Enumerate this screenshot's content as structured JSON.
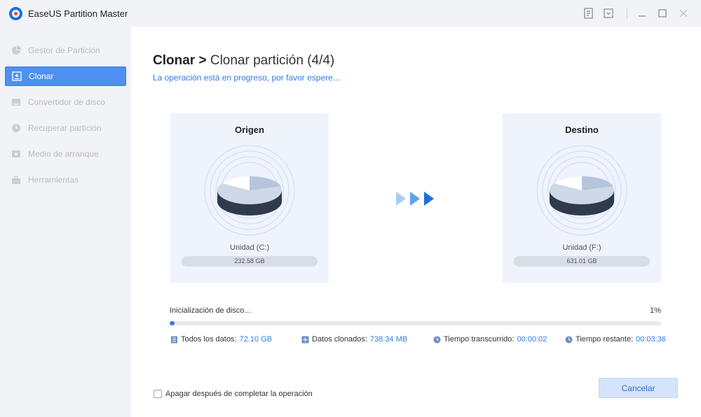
{
  "app": {
    "title": "EaseUS Partition Master"
  },
  "sidebar": {
    "items": [
      {
        "label": "Gestor de Partición",
        "icon": "pie-chart-icon",
        "active": false
      },
      {
        "label": "Clonar",
        "icon": "clone-icon",
        "active": true
      },
      {
        "label": "Convertidor de disco",
        "icon": "disk-convert-icon",
        "active": false
      },
      {
        "label": "Recuperar partición",
        "icon": "recover-icon",
        "active": false
      },
      {
        "label": "Medio de arranque",
        "icon": "boot-media-icon",
        "active": false
      },
      {
        "label": "Herramientas",
        "icon": "toolbox-icon",
        "active": false
      }
    ]
  },
  "main": {
    "heading_bold": "Clonar >",
    "heading_rest": "Clonar partición (4/4)",
    "subtitle": "La operación está en progreso, por favor espere...",
    "source": {
      "title": "Origen",
      "drive": "Unidad (C:)",
      "capacity": "232.58 GB"
    },
    "target": {
      "title": "Destino",
      "drive": "Unidad (F:)",
      "capacity": "631.01 GB"
    },
    "progress": {
      "label": "Inicialización de disco...",
      "percent_text": "1%",
      "percent": 1
    },
    "stats": {
      "total_label": "Todos los datos:",
      "total_value": "72.10 GB",
      "cloned_label": "Datos clonados:",
      "cloned_value": "738.34 MB",
      "elapsed_label": "Tiempo transcurrido:",
      "elapsed_value": "00:00:02",
      "remaining_label": "Tiempo restante:",
      "remaining_value": "00:03:36"
    },
    "shutdown_label": "Apagar después de completar la operación",
    "cancel_label": "Cancelar"
  },
  "colors": {
    "accent": "#2f7be5",
    "sidebar_active": "#4f8ff0",
    "card_bg": "#eef3fc"
  }
}
